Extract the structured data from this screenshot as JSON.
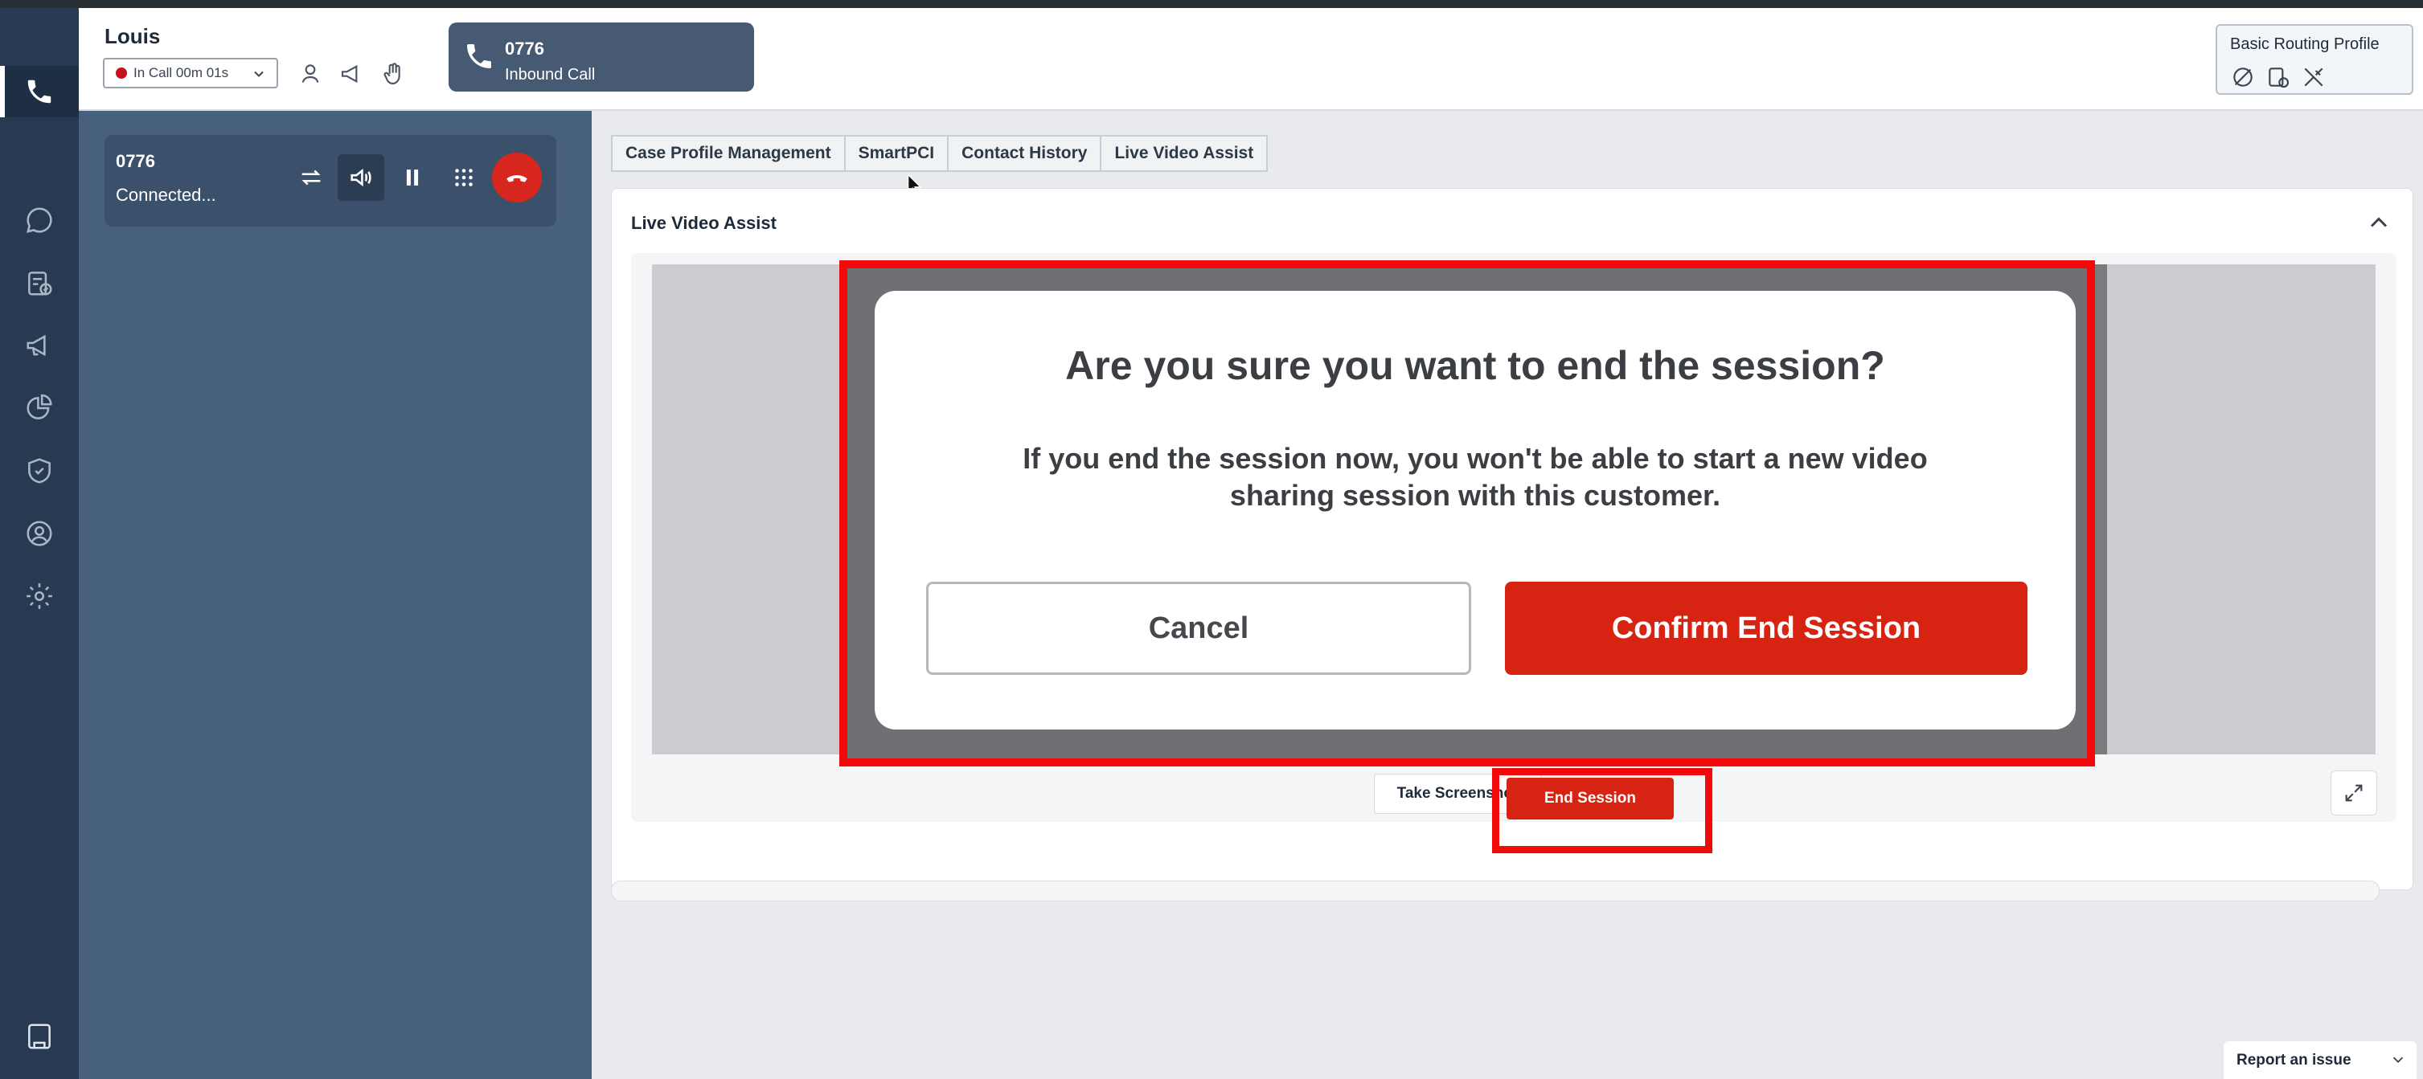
{
  "header": {
    "agent_name": "Louis",
    "status_label": "In Call 00m 01s",
    "status_color": "#c4121a",
    "icons": [
      "person-icon",
      "megaphone-icon",
      "hand-raise-icon"
    ]
  },
  "active_call": {
    "number": "0776",
    "type": "Inbound Call",
    "icon": "phone-icon"
  },
  "routing_profile": {
    "title": "Basic Routing Profile",
    "icons": [
      "no-calls-icon",
      "task-icon",
      "tools-icon"
    ]
  },
  "sidebar": {
    "items": [
      {
        "icon": "phone-icon",
        "active": true
      },
      {
        "icon": "chat-icon",
        "active": false
      },
      {
        "icon": "tasks-icon",
        "active": false
      },
      {
        "icon": "megaphone-icon",
        "active": false
      },
      {
        "icon": "pie-chart-icon",
        "active": false
      },
      {
        "icon": "shield-icon",
        "active": false
      },
      {
        "icon": "profile-icon",
        "active": false
      },
      {
        "icon": "gear-icon",
        "active": false
      }
    ],
    "bottom_icon": "notes-icon"
  },
  "contact": {
    "number": "0776",
    "status": "Connected...",
    "controls": [
      "transfer-icon",
      "speaker-icon",
      "pause-icon",
      "keypad-icon",
      "hangup-icon"
    ]
  },
  "tabs": [
    {
      "label": "Case Profile Management"
    },
    {
      "label": "SmartPCI"
    },
    {
      "label": "Contact History"
    },
    {
      "label": "Live Video Assist"
    }
  ],
  "live_video_assist": {
    "title": "Live Video Assist",
    "take_screenshot_label": "Take Screenshot",
    "end_session_label": "End Session"
  },
  "dialog": {
    "title": "Are you sure you want to end the session?",
    "message_line1": "If you end the session now, you won't be able to start a new video",
    "message_line2": "sharing session with this customer.",
    "cancel_label": "Cancel",
    "confirm_label": "Confirm End Session"
  },
  "footer": {
    "report_label": "Report an issue"
  },
  "colors": {
    "rail": "#283a52",
    "panel": "#46607e",
    "danger": "#d72311",
    "highlight": "#f20a0a"
  }
}
